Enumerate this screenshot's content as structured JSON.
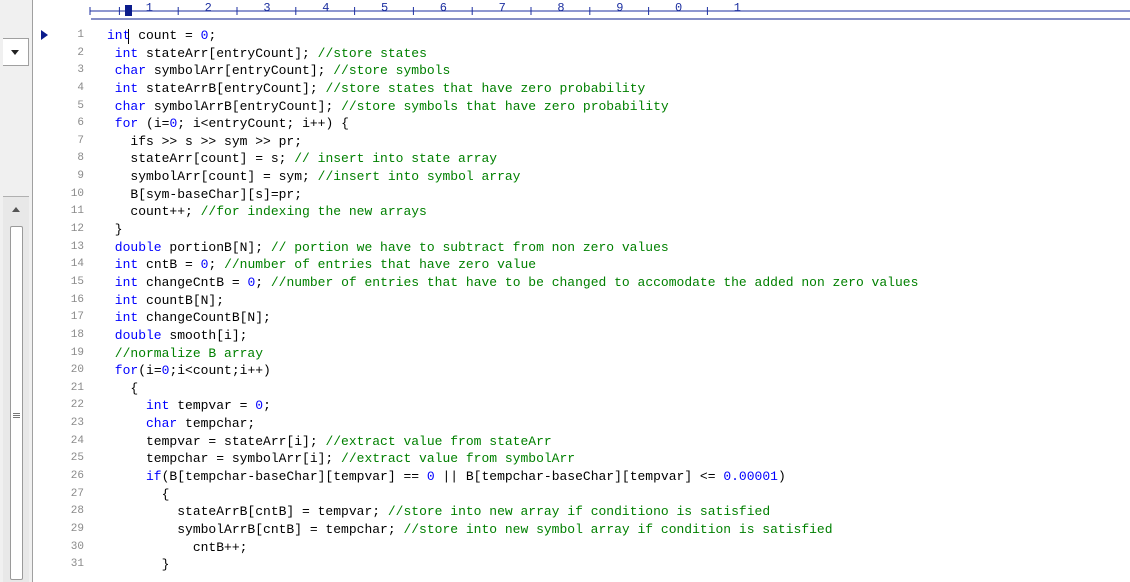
{
  "colors": {
    "keyword": "#0000ff",
    "comment": "#008000",
    "number": "#0000ff",
    "text": "#000000",
    "line_number": "#8a8a8a",
    "ruler": "#1c2fa0",
    "current_line_marker": "#0b1c8c"
  },
  "icons": {
    "dropdown": "chevron-down-icon",
    "scroll_up": "arrow-up-icon",
    "grip": "scrollbar-grip-icon",
    "current_line": "current-line-marker-icon"
  },
  "ruler": {
    "text": "|--·-+----1----+----2----+----3----+----4----+----5----+----6----+----7----+----8----+----9----+----0----+----1",
    "labels": [
      "1",
      "2",
      "3",
      "4",
      "5",
      "6",
      "7",
      "8",
      "9",
      "0",
      "1"
    ]
  },
  "lines": [
    {
      "num": "1",
      "segs": [
        {
          "t": "int",
          "c": "kw"
        },
        {
          "t": " count = ",
          "c": "tx"
        },
        {
          "t": "0",
          "c": "nm"
        },
        {
          "t": ";",
          "c": "tx"
        }
      ]
    },
    {
      "num": "2",
      "segs": [
        {
          "t": " int",
          "c": "kw"
        },
        {
          "t": " stateArr[entryCount]; ",
          "c": "tx"
        },
        {
          "t": "//store states",
          "c": "cm"
        }
      ]
    },
    {
      "num": "3",
      "segs": [
        {
          "t": " char",
          "c": "kw"
        },
        {
          "t": " symbolArr[entryCount]; ",
          "c": "tx"
        },
        {
          "t": "//store symbols",
          "c": "cm"
        }
      ]
    },
    {
      "num": "4",
      "segs": [
        {
          "t": " int",
          "c": "kw"
        },
        {
          "t": " stateArrB[entryCount]; ",
          "c": "tx"
        },
        {
          "t": "//store states that have zero probability",
          "c": "cm"
        }
      ]
    },
    {
      "num": "5",
      "segs": [
        {
          "t": " char",
          "c": "kw"
        },
        {
          "t": " symbolArrB[entryCount]; ",
          "c": "tx"
        },
        {
          "t": "//store symbols that have zero probability",
          "c": "cm"
        }
      ]
    },
    {
      "num": "6",
      "segs": [
        {
          "t": " for",
          "c": "kw"
        },
        {
          "t": " (i=",
          "c": "tx"
        },
        {
          "t": "0",
          "c": "nm"
        },
        {
          "t": "; i<entryCount; i++) {",
          "c": "tx"
        }
      ]
    },
    {
      "num": "7",
      "segs": [
        {
          "t": "   ifs >> s >> sym >> pr;",
          "c": "tx"
        }
      ]
    },
    {
      "num": "8",
      "segs": [
        {
          "t": "   stateArr[count] = s; ",
          "c": "tx"
        },
        {
          "t": "// insert into state array",
          "c": "cm"
        }
      ]
    },
    {
      "num": "9",
      "segs": [
        {
          "t": "   symbolArr[count] = sym; ",
          "c": "tx"
        },
        {
          "t": "//insert into symbol array",
          "c": "cm"
        }
      ]
    },
    {
      "num": "10",
      "segs": [
        {
          "t": "   B[sym-baseChar][s]=pr;",
          "c": "tx"
        }
      ]
    },
    {
      "num": "11",
      "segs": [
        {
          "t": "   count++; ",
          "c": "tx"
        },
        {
          "t": "//for indexing the new arrays",
          "c": "cm"
        }
      ]
    },
    {
      "num": "12",
      "segs": [
        {
          "t": " }",
          "c": "tx"
        }
      ]
    },
    {
      "num": "13",
      "segs": [
        {
          "t": " double",
          "c": "kw"
        },
        {
          "t": " portionB[N]; ",
          "c": "tx"
        },
        {
          "t": "// portion we have to subtract from non zero values",
          "c": "cm"
        }
      ]
    },
    {
      "num": "14",
      "segs": [
        {
          "t": " int",
          "c": "kw"
        },
        {
          "t": " cntB = ",
          "c": "tx"
        },
        {
          "t": "0",
          "c": "nm"
        },
        {
          "t": "; ",
          "c": "tx"
        },
        {
          "t": "//number of entries that have zero value",
          "c": "cm"
        }
      ]
    },
    {
      "num": "15",
      "segs": [
        {
          "t": " int",
          "c": "kw"
        },
        {
          "t": " changeCntB = ",
          "c": "tx"
        },
        {
          "t": "0",
          "c": "nm"
        },
        {
          "t": "; ",
          "c": "tx"
        },
        {
          "t": "//number of entries that have to be changed to accomodate the added non zero values",
          "c": "cm"
        }
      ]
    },
    {
      "num": "16",
      "segs": [
        {
          "t": " int",
          "c": "kw"
        },
        {
          "t": " countB[N];",
          "c": "tx"
        }
      ]
    },
    {
      "num": "17",
      "segs": [
        {
          "t": " int",
          "c": "kw"
        },
        {
          "t": " changeCountB[N];",
          "c": "tx"
        }
      ]
    },
    {
      "num": "18",
      "segs": [
        {
          "t": " double",
          "c": "kw"
        },
        {
          "t": " smooth[i];",
          "c": "tx"
        }
      ]
    },
    {
      "num": "19",
      "segs": [
        {
          "t": " //normalize B array",
          "c": "cm"
        }
      ]
    },
    {
      "num": "20",
      "segs": [
        {
          "t": " for",
          "c": "kw"
        },
        {
          "t": "(i=",
          "c": "tx"
        },
        {
          "t": "0",
          "c": "nm"
        },
        {
          "t": ";i<count;i++)",
          "c": "tx"
        }
      ]
    },
    {
      "num": "21",
      "segs": [
        {
          "t": "   {",
          "c": "tx"
        }
      ]
    },
    {
      "num": "22",
      "segs": [
        {
          "t": "     int",
          "c": "kw"
        },
        {
          "t": " tempvar = ",
          "c": "tx"
        },
        {
          "t": "0",
          "c": "nm"
        },
        {
          "t": ";",
          "c": "tx"
        }
      ]
    },
    {
      "num": "23",
      "segs": [
        {
          "t": "     char",
          "c": "kw"
        },
        {
          "t": " tempchar;",
          "c": "tx"
        }
      ]
    },
    {
      "num": "24",
      "segs": [
        {
          "t": "     tempvar = stateArr[i]; ",
          "c": "tx"
        },
        {
          "t": "//extract value from stateArr",
          "c": "cm"
        }
      ]
    },
    {
      "num": "25",
      "segs": [
        {
          "t": "     tempchar = symbolArr[i]; ",
          "c": "tx"
        },
        {
          "t": "//extract value from symbolArr",
          "c": "cm"
        }
      ]
    },
    {
      "num": "26",
      "segs": [
        {
          "t": "     if",
          "c": "kw"
        },
        {
          "t": "(B[tempchar-baseChar][tempvar] == ",
          "c": "tx"
        },
        {
          "t": "0",
          "c": "nm"
        },
        {
          "t": " || B[tempchar-baseChar][tempvar] <= ",
          "c": "tx"
        },
        {
          "t": "0.00001",
          "c": "nm"
        },
        {
          "t": ")",
          "c": "tx"
        }
      ]
    },
    {
      "num": "27",
      "segs": [
        {
          "t": "       {",
          "c": "tx"
        }
      ]
    },
    {
      "num": "28",
      "segs": [
        {
          "t": "         stateArrB[cntB] = tempvar; ",
          "c": "tx"
        },
        {
          "t": "//store into new array if conditiono is satisfied",
          "c": "cm"
        }
      ]
    },
    {
      "num": "29",
      "segs": [
        {
          "t": "         symbolArrB[cntB] = tempchar; ",
          "c": "tx"
        },
        {
          "t": "//store into new symbol array if condition is satisfied",
          "c": "cm"
        }
      ]
    },
    {
      "num": "30",
      "segs": [
        {
          "t": "           cntB++;",
          "c": "tx"
        }
      ]
    },
    {
      "num": "31",
      "segs": [
        {
          "t": "       }",
          "c": "tx"
        }
      ]
    }
  ]
}
